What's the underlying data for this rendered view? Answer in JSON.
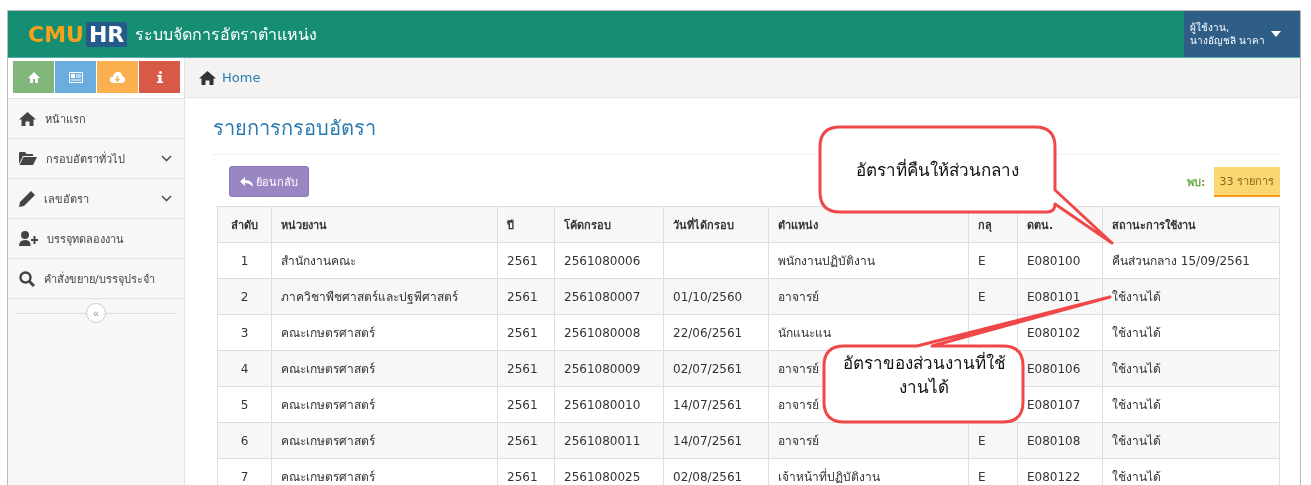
{
  "header": {
    "logo_cmu": "CMU",
    "logo_hr": "HR",
    "title": "ระบบจัดการอัตราตำแหน่ง",
    "user_label": "ผู้ใช้งาน,",
    "user_name": "นางอัญชลิ นาคา"
  },
  "quick_buttons": [
    {
      "kind": "home",
      "color": "#82b77b"
    },
    {
      "kind": "news",
      "color": "#6aaee0"
    },
    {
      "kind": "cloud",
      "color": "#fab04e"
    },
    {
      "kind": "info",
      "color": "#d65a46"
    }
  ],
  "breadcrumb": "Home",
  "sidebar": {
    "items": [
      {
        "kind": "home",
        "label": "หน้าแรก",
        "has_submenu": false
      },
      {
        "kind": "folder",
        "label": "กรอบอัตราทั่วไป",
        "has_submenu": true
      },
      {
        "kind": "pencil",
        "label": "เลขอัตรา",
        "has_submenu": true
      },
      {
        "kind": "user-add",
        "label": "บรรจุทดลองงาน",
        "has_submenu": false
      },
      {
        "kind": "search",
        "label": "คำสั่งขยาย/บรรจุประจำ",
        "has_submenu": false
      }
    ],
    "collapse": "«"
  },
  "page_title": "รายการกรอบอัตรา",
  "back_button": "ย้อนกลับ",
  "found": {
    "label": "พบ:",
    "count": "33 รายการ"
  },
  "table": {
    "columns": [
      "ลำดับ",
      "หน่วยงาน",
      "ปี",
      "โค้ดกรอบ",
      "วันที่ได้กรอบ",
      "ตำแหน่ง",
      "กลุ",
      "ดตน.",
      "สถานะการใช้งาน"
    ],
    "rows": [
      [
        "1",
        "สำนักงานคณะ",
        "2561",
        "2561080006",
        "",
        "พนักงานปฏิบัติงาน",
        "E",
        "E080100",
        "คืนส่วนกลาง 15/09/2561"
      ],
      [
        "2",
        "ภาควิชาพืชศาสตร์และปฐพีศาสตร์",
        "2561",
        "2561080007",
        "01/10/2560",
        "อาจารย์",
        "E",
        "E080101",
        "ใช้งานได้"
      ],
      [
        "3",
        "คณะเกษตรศาสตร์",
        "2561",
        "2561080008",
        "22/06/2561",
        "นักแนะแน",
        "",
        "E080102",
        "ใช้งานได้"
      ],
      [
        "4",
        "คณะเกษตรศาสตร์",
        "2561",
        "2561080009",
        "02/07/2561",
        "อาจารย์",
        "",
        "E080106",
        "ใช้งานได้"
      ],
      [
        "5",
        "คณะเกษตรศาสตร์",
        "2561",
        "2561080010",
        "14/07/2561",
        "อาจารย์",
        "",
        "E080107",
        "ใช้งานได้"
      ],
      [
        "6",
        "คณะเกษตรศาสตร์",
        "2561",
        "2561080011",
        "14/07/2561",
        "อาจารย์",
        "E",
        "E080108",
        "ใช้งานได้"
      ],
      [
        "7",
        "คณะเกษตรศาสตร์",
        "2561",
        "2561080025",
        "02/08/2561",
        "เจ้าหน้าที่ปฏิบัติงาน",
        "E",
        "E080122",
        "ใช้งานได้"
      ]
    ]
  },
  "callouts": [
    {
      "text": "อัตราที่คืนให้ส่วนกลาง"
    },
    {
      "text": "อัตราของส่วนงานที่ใช้งานได้"
    }
  ]
}
